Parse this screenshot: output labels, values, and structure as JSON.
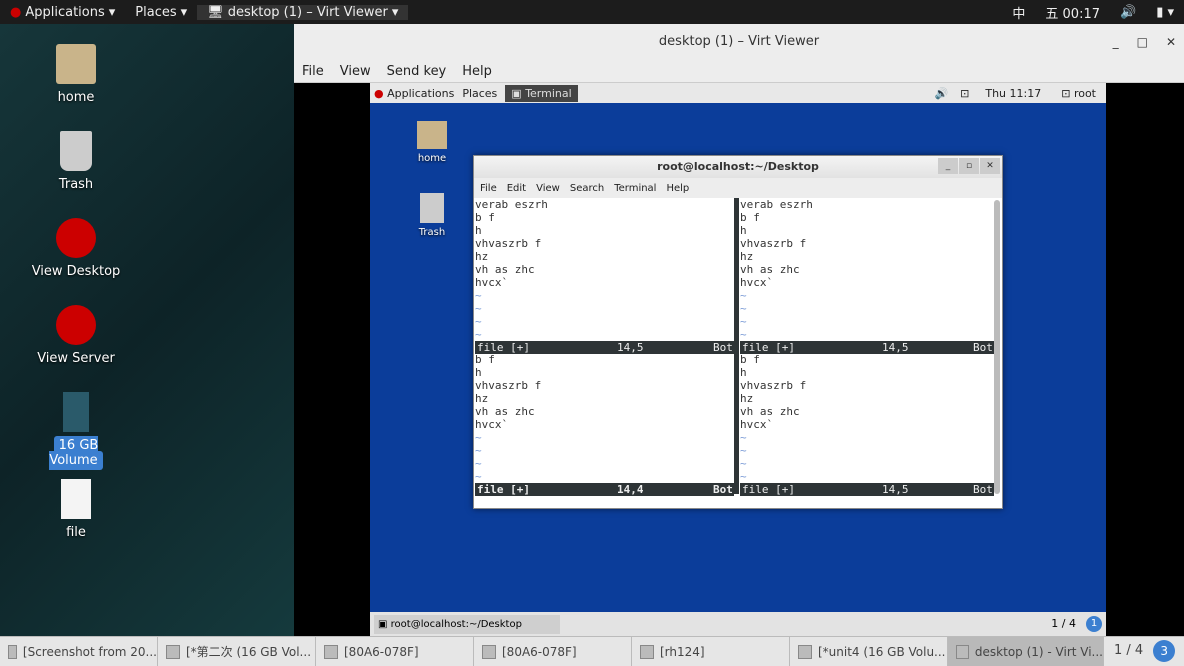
{
  "topbar": {
    "applications": "Applications",
    "places": "Places",
    "window": "desktop (1) – Virt Viewer",
    "ime": "中",
    "clock": "五 00:17"
  },
  "host_icons": [
    "home",
    "Trash",
    "View Desktop",
    "View Server",
    "16 GB Volume",
    "file"
  ],
  "viewer": {
    "title": "desktop (1) – Virt Viewer",
    "menu": [
      "File",
      "View",
      "Send key",
      "Help"
    ],
    "ctl": [
      "_",
      "□",
      "✕"
    ]
  },
  "guest": {
    "applications": "Applications",
    "places": "Places",
    "terminal": "Terminal",
    "clock": "Thu 11:17",
    "user": "root",
    "icons": [
      "home",
      "Trash"
    ],
    "bottom_task": "root@localhost:~/Desktop",
    "workspace": "1 / 4",
    "notif": "1"
  },
  "terminal": {
    "title": "root@localhost:~/Desktop",
    "menu": [
      "File",
      "Edit",
      "View",
      "Search",
      "Terminal",
      "Help"
    ],
    "top_lines": [
      "verab eszrh",
      "b f",
      "h",
      "vhvaszrb f",
      "hz",
      "vh as zhc",
      "hvcx`"
    ],
    "bottom_lines": [
      "b f",
      "h",
      "vhvaszrb f",
      "hz",
      "vh as zhc",
      "hvcx`"
    ],
    "status": {
      "file": "file [+]",
      "pos_a": "14,5",
      "pos_active": "14,4",
      "bot": "Bot"
    }
  },
  "taskbar": {
    "items": [
      "[Screenshot from 20...",
      "[*第二次 (16 GB Vol...",
      "[80A6-078F]",
      "[80A6-078F]",
      "[rh124]",
      "[*unit4 (16 GB Volu...",
      "desktop (1) - Virt Vi..."
    ],
    "workspace": "1 / 4",
    "notif": "3"
  }
}
